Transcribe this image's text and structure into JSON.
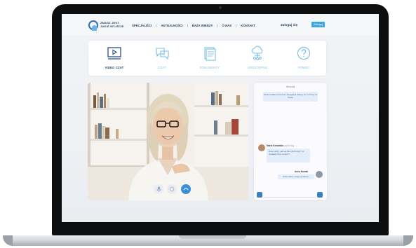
{
  "brand": {
    "line1": "ZMASZ JEST",
    "line2": "JAKIŚ WYJŚCIE"
  },
  "nav": {
    "items": [
      "SPECJALIŚCI",
      "AKTUALNOŚCI",
      "BAZA WIEDZY",
      "O NAS",
      "KONTAKT"
    ],
    "signin_label": "Zaloguj się",
    "login_button": "Zaloguj"
  },
  "categories": [
    {
      "label": "VIDEO CZAT",
      "icon": "video-icon",
      "active": true
    },
    {
      "label": "CZAT",
      "icon": "chat-bubbles-icon",
      "active": false
    },
    {
      "label": "DOKUMENTY",
      "icon": "documents-icon",
      "active": false
    },
    {
      "label": "UDOSTĘPNIJ",
      "icon": "cloud-share-icon",
      "active": false
    },
    {
      "label": "POMOC",
      "icon": "help-icon",
      "active": false
    }
  ],
  "video_controls": [
    {
      "name": "microphone-button",
      "icon": "microphone-icon"
    },
    {
      "name": "camera-button",
      "icon": "camera-icon"
    },
    {
      "name": "end-call-button",
      "icon": "phone-icon"
    }
  ],
  "chat": {
    "header": "Wczoraj",
    "system_message": "Sesja została rozpoczęta. Specjalista dołączy do rozmowy za chwilę.",
    "message": {
      "author": "Maria Kowalska",
      "time": "psycholog",
      "text": "Dzień dobry. Jak się Pani dziś czuje? Co chciałaby Pani omówić?"
    },
    "reply": {
      "author": "Anna Nowak",
      "text": "Dzień dobry, czuję się dobrze."
    }
  },
  "colors": {
    "navy": "#1d3e66",
    "accent": "#3ba7e0",
    "icon_inactive": "#7bc0e6",
    "bubble": "#e3eefa"
  }
}
